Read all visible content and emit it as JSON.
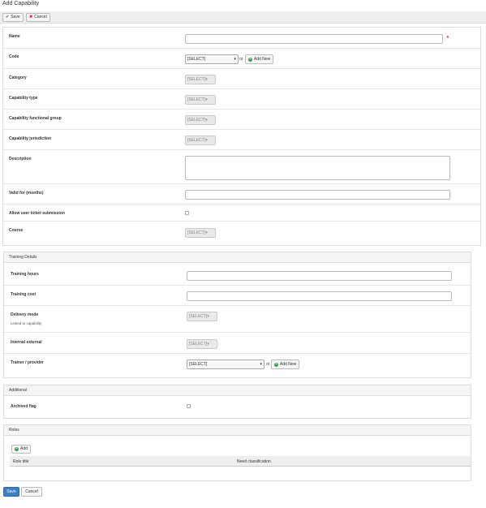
{
  "page": {
    "title": "Add Capability"
  },
  "toolbar": {
    "save": "Save",
    "cancel": "Cancel"
  },
  "form": {
    "name": "Name",
    "code": "Code",
    "code_select": "[SELECT]",
    "or": "or",
    "add_new": "Add New",
    "category": "Category",
    "capability_type": "Capability type",
    "functional_group": "Capability functional group",
    "jurisdiction": "Capability jurisdiction",
    "description": "Description",
    "valid_for": "Valid for (months)",
    "allow_ticket": "Allow user ticket submission",
    "course": "Course",
    "select_placeholder": "[SELECT]"
  },
  "training": {
    "heading": "Training Details",
    "hours": "Training hours",
    "cost": "Training cost",
    "delivery_mode": "Delivery mode",
    "linked": "Linked to capability",
    "internal_external": "Internal external",
    "trainer": "Trainer / provider",
    "trainer_select": "[SELECT]"
  },
  "additional": {
    "heading": "Additional",
    "archived": "Archived flag"
  },
  "roles": {
    "heading": "Roles",
    "add": "Add",
    "columns": [
      "Role title",
      "Need classification"
    ]
  },
  "footer": {
    "save": "Save",
    "cancel": "Cancel"
  },
  "colors": {
    "primary": "#3c7fc3",
    "required": "#d9534f",
    "add_icon": "#3a9b3a"
  }
}
